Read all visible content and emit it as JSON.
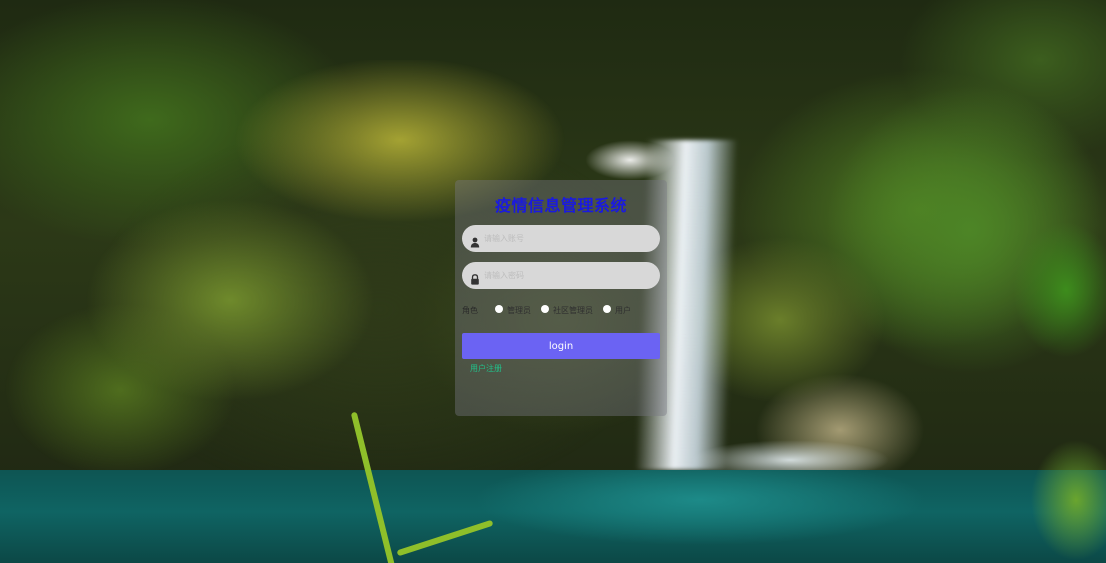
{
  "background": {
    "description_icon": "waterfall-photo"
  },
  "login": {
    "title": "疫情信息管理系统",
    "username_placeholder": "请输入账号",
    "password_placeholder": "请输入密码",
    "role_label": "角色",
    "roles": [
      "管理员",
      "社区管理员",
      "用户"
    ],
    "login_label": "login",
    "register_label": "用户注册"
  },
  "colors": {
    "title": "#1a1adf",
    "login_button": "#6b63f3",
    "register_link": "#22c08a",
    "field_bg": "#d8d8d8"
  }
}
